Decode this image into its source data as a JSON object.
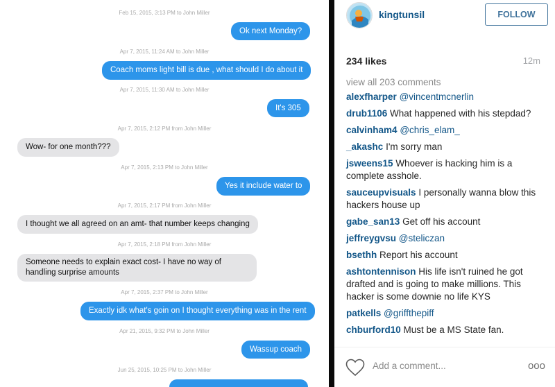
{
  "messages": [
    {
      "timestamp": "Feb 15, 2015, 3:13 PM to John Miller",
      "text": "Ok next Monday?",
      "dir": "out"
    },
    {
      "timestamp": "Apr 7, 2015, 11:24 AM to John Miller",
      "text": "Coach moms light bill is due , what should I do about it",
      "dir": "out"
    },
    {
      "timestamp": "Apr 7, 2015, 11:30 AM to John Miller",
      "text": "It's 305",
      "dir": "out"
    },
    {
      "timestamp": "Apr 7, 2015, 2:12 PM from John Miller",
      "text": "Wow- for one month???",
      "dir": "in"
    },
    {
      "timestamp": "Apr 7, 2015, 2:13 PM to John Miller",
      "text": "Yes it include water to",
      "dir": "out"
    },
    {
      "timestamp": "Apr 7, 2015, 2:17 PM from John Miller",
      "text": "I thought we all agreed on an amt- that number keeps changing",
      "dir": "in"
    },
    {
      "timestamp": "Apr 7, 2015, 2:18 PM from John Miller",
      "text": "Someone needs to explain exact cost- I have no way of handling surprise amounts",
      "dir": "in"
    },
    {
      "timestamp": "Apr 7, 2015, 2:37 PM to John Miller",
      "text": "Exactly idk what's goin on I thought everything was in the rent",
      "dir": "out"
    },
    {
      "timestamp": "Apr 21, 2015, 9:32 PM to John Miller",
      "text": "Wassup coach",
      "dir": "out"
    },
    {
      "timestamp": "Jun 25, 2015, 10:25 PM to John Miller",
      "text": "",
      "dir": "out"
    }
  ],
  "post": {
    "username": "kingtunsil",
    "follow_label": "FOLLOW",
    "likes": "234 likes",
    "age": "12m",
    "view_all": "view all 203 comments",
    "add_comment_placeholder": "Add a comment...",
    "more_label": "ooo",
    "comments": [
      {
        "user": "alexfharper",
        "mention": "@vincentmcnerlin",
        "text": ""
      },
      {
        "user": "drub1106",
        "mention": "",
        "text": "What happened with his stepdad?"
      },
      {
        "user": "calvinham4",
        "mention": "@chris_elam_",
        "text": ""
      },
      {
        "user": "_akashc",
        "mention": "",
        "text": "I'm sorry man"
      },
      {
        "user": "jsweens15",
        "mention": "",
        "text": "Whoever is hacking him is a complete asshole."
      },
      {
        "user": "sauceupvisuals",
        "mention": "",
        "text": "I personally wanna blow this hackers house up"
      },
      {
        "user": "gabe_san13",
        "mention": "",
        "text": "Get off his account"
      },
      {
        "user": "jeffreygvsu",
        "mention": "@steliczan",
        "text": ""
      },
      {
        "user": "bsethh",
        "mention": "",
        "text": "Report his account"
      },
      {
        "user": "ashtontennison",
        "mention": "",
        "text": "His life isn't ruined he got drafted and is going to make millions. This hacker is some downie no life KYS"
      },
      {
        "user": "patkells",
        "mention": "@griffthepiff",
        "text": ""
      },
      {
        "user": "chburford10",
        "mention": "",
        "text": "Must be a MS State fan."
      }
    ]
  },
  "icons": {
    "heart": "heart-icon",
    "more": "more-options-icon",
    "avatar": "avatar"
  },
  "colors": {
    "outgoing_bubble": "#2d95ea",
    "incoming_bubble": "#e4e4e6",
    "username": "#125688",
    "follow_border": "#3f729b"
  }
}
